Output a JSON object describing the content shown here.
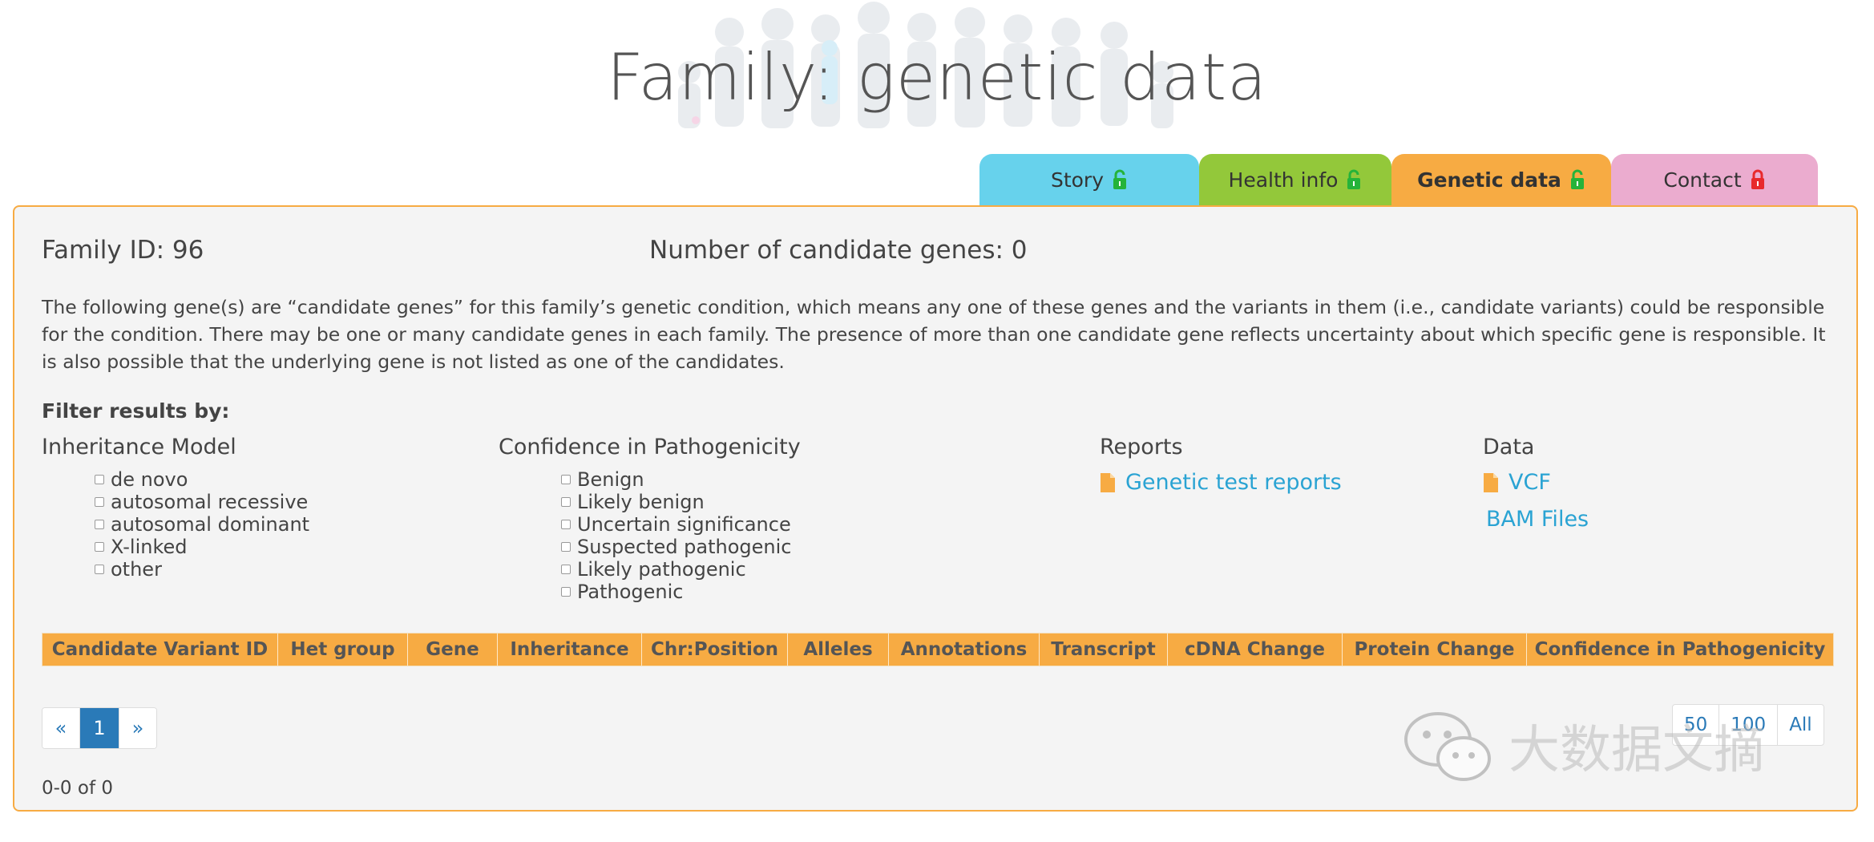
{
  "page_title": "Family: genetic data",
  "tabs": [
    {
      "label": "Story",
      "lock": "unlocked-lock-icon",
      "color": "#67d2ec"
    },
    {
      "label": "Health info",
      "lock": "unlocked-lock-icon",
      "color": "#93c83a"
    },
    {
      "label": "Genetic data",
      "lock": "unlocked-lock-icon",
      "color": "#f7ab43",
      "active": true
    },
    {
      "label": "Contact",
      "lock": "locked-lock-icon",
      "color": "#ebaccf"
    }
  ],
  "family_id": "Family ID: 96",
  "num_candidate_genes": "Number of candidate genes: 0",
  "description": "The following gene(s) are “candidate genes” for this family’s genetic condition, which means any one of these genes and the variants in them (i.e., candidate variants) could be responsible for the condition. There may be one or many candidate genes in each family. The presence of more than one candidate gene reflects uncertainty about which specific gene is responsible. It is also possible that the underlying gene is not listed as one of the candidates.",
  "filter_title": "Filter results by:",
  "inheritance": {
    "heading": "Inheritance Model",
    "options": [
      "de novo",
      "autosomal recessive",
      "autosomal dominant",
      "X-linked",
      "other"
    ]
  },
  "confidence": {
    "heading": "Confidence in Pathogenicity",
    "options": [
      "Benign",
      "Likely benign",
      "Uncertain significance",
      "Suspected pathogenic",
      "Likely pathogenic",
      "Pathogenic"
    ]
  },
  "reports": {
    "heading": "Reports",
    "link": "Genetic test reports"
  },
  "data_section": {
    "heading": "Data",
    "vcf": "VCF",
    "bam": "BAM Files"
  },
  "table_headers": [
    "Candidate Variant ID",
    "Het group",
    "Gene",
    "Inheritance",
    "Chr:Position",
    "Alleles",
    "Annotations",
    "Transcript",
    "cDNA Change",
    "Protein Change",
    "Confidence in Pathogenicity"
  ],
  "pagination": {
    "prev": "«",
    "current": "1",
    "next": "»"
  },
  "count_text": "0-0 of 0",
  "page_sizes": [
    "50",
    "100",
    "All"
  ],
  "watermark": "大数据文摘",
  "colors": {
    "accent": "#f7ab43",
    "link": "#2aa3d3",
    "active_page": "#2a7ab8"
  }
}
